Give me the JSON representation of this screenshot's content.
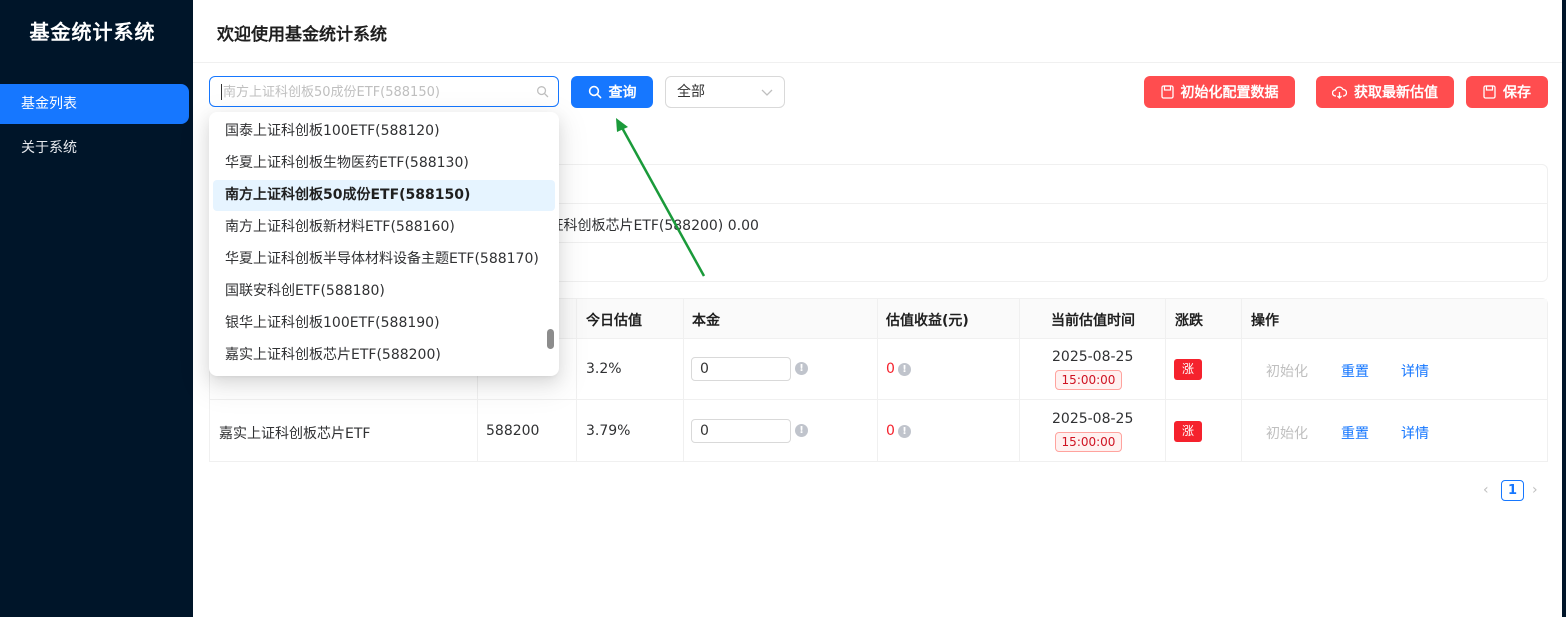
{
  "app": {
    "title": "基金统计系统"
  },
  "sidebar": {
    "items": [
      {
        "label": "基金列表"
      },
      {
        "label": "关于系统"
      }
    ]
  },
  "header": {
    "title": "欢迎使用基金统计系统"
  },
  "toolbar": {
    "search_placeholder": "南方上证科创板50成份ETF(588150)",
    "query_label": "查询",
    "filter_value": "全部",
    "init_config_label": "初始化配置数据",
    "fetch_label": "获取最新估值",
    "save_label": "保存"
  },
  "summary": {
    "text": "成份ETF(588150) 0.00，嘉实上证科创板芯片ETF(588200) 0.00"
  },
  "table": {
    "headers": [
      "今日估值",
      "本金",
      "估值收益(元)",
      "当前估值时间",
      "涨跌",
      "操作"
    ],
    "rows": [
      {
        "name": "",
        "code": "",
        "estimate": "3.2%",
        "principal": "0",
        "profit": "0",
        "date": "2025-08-25",
        "time": "15:00:00",
        "change": "涨",
        "op_init": "初始化",
        "op_reset": "重置",
        "op_detail": "详情"
      },
      {
        "name": "嘉实上证科创板芯片ETF",
        "code": "588200",
        "estimate": "3.79%",
        "principal": "0",
        "profit": "0",
        "date": "2025-08-25",
        "time": "15:00:00",
        "change": "涨",
        "op_init": "初始化",
        "op_reset": "重置",
        "op_detail": "详情"
      }
    ]
  },
  "dropdown": {
    "options": [
      "国泰上证科创板100ETF(588120)",
      "华夏上证科创板生物医药ETF(588130)",
      "南方上证科创板50成份ETF(588150)",
      "南方上证科创板新材料ETF(588160)",
      "华夏上证科创板半导体材料设备主题ETF(588170)",
      "国联安科创ETF(588180)",
      "银华上证科创板100ETF(588190)",
      "嘉实上证科创板芯片ETF(588200)"
    ],
    "selected": "南方上证科创板50成份ETF(588150)"
  },
  "pagination": {
    "current": "1"
  },
  "colors": {
    "primary": "#1677ff",
    "danger": "#ff4d4f",
    "sidebar": "#001529",
    "rise": "#f5222d",
    "arrow": "#1a9a3a"
  },
  "icons": [
    "search-icon",
    "save-icon",
    "cloud-download-icon",
    "chevron-down-icon",
    "info-icon",
    "arrow-annotation"
  ]
}
